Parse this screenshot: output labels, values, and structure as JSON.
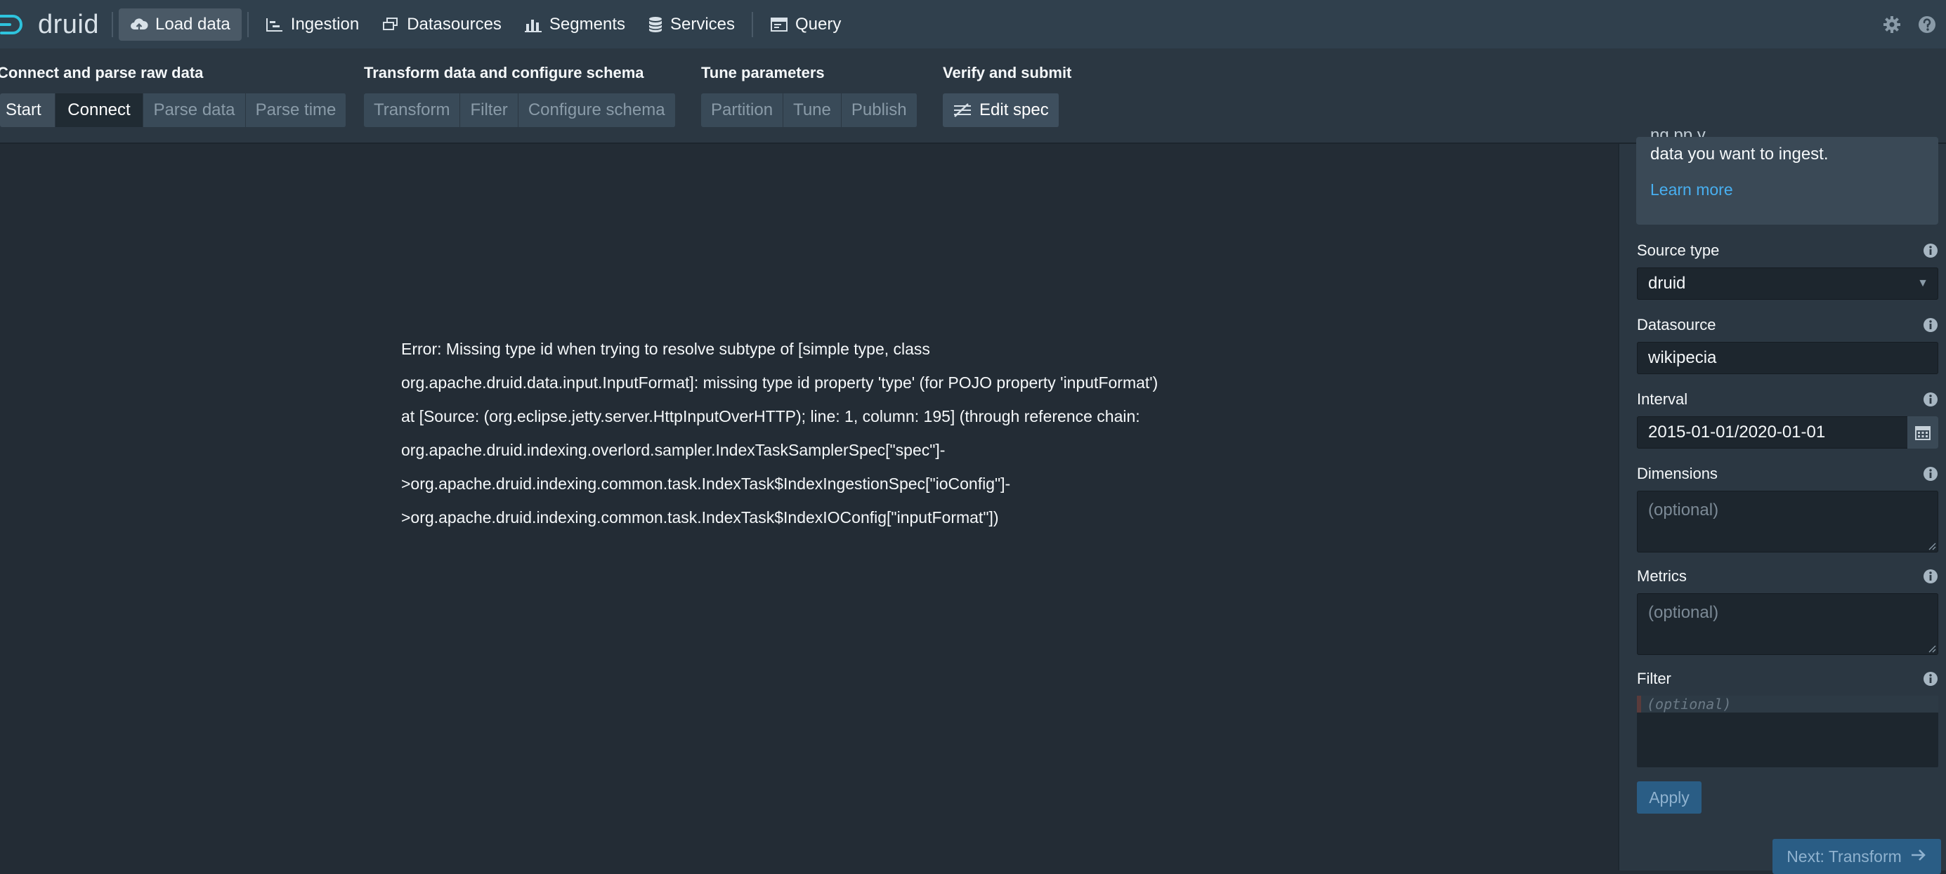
{
  "nav": {
    "logo_text": "druid",
    "items": [
      {
        "label": "Load data",
        "icon": "cloud-upload-icon"
      },
      {
        "label": "Ingestion",
        "icon": "gantt-chart-icon"
      },
      {
        "label": "Datasources",
        "icon": "multi-select-icon"
      },
      {
        "label": "Segments",
        "icon": "stacked-chart-icon"
      },
      {
        "label": "Services",
        "icon": "database-icon"
      },
      {
        "label": "Query",
        "icon": "application-icon"
      }
    ],
    "right_icons": [
      "cog-icon",
      "help-icon"
    ]
  },
  "steps": {
    "groups": [
      {
        "title": "Connect and parse raw data",
        "steps": [
          "Start",
          "Connect",
          "Parse data",
          "Parse time"
        ]
      },
      {
        "title": "Transform data and configure schema",
        "steps": [
          "Transform",
          "Filter",
          "Configure schema"
        ]
      },
      {
        "title": "Tune parameters",
        "steps": [
          "Partition",
          "Tune",
          "Publish"
        ]
      },
      {
        "title": "Verify and submit",
        "steps": [
          "Edit spec"
        ]
      }
    ]
  },
  "main": {
    "error_lines": [
      "Error: Missing type id when trying to resolve subtype of [simple type, class",
      "org.apache.druid.data.input.InputFormat]: missing type id property 'type' (for POJO property 'inputFormat')",
      "at [Source: (org.eclipse.jetty.server.HttpInputOverHTTP); line: 1, column: 195] (through reference chain:",
      "org.apache.druid.indexing.overlord.sampler.IndexTaskSamplerSpec[\"spec\"]-",
      ">org.apache.druid.indexing.common.task.IndexTask$IndexIngestionSpec[\"ioConfig\"]-",
      ">org.apache.druid.indexing.common.task.IndexTask$IndexIOConfig[\"inputFormat\"])"
    ]
  },
  "sidebar": {
    "callout": {
      "partial_text": "ng       pp       y",
      "text": "data you want to ingest.",
      "link": "Learn more"
    },
    "source_type": {
      "label": "Source type",
      "value": "druid"
    },
    "datasource": {
      "label": "Datasource",
      "value": "wikipecia"
    },
    "interval": {
      "label": "Interval",
      "value": "2015-01-01/2020-01-01"
    },
    "dimensions": {
      "label": "Dimensions",
      "placeholder": "(optional)"
    },
    "metrics": {
      "label": "Metrics",
      "placeholder": "(optional)"
    },
    "filter": {
      "label": "Filter",
      "placeholder": "(optional)"
    },
    "apply_label": "Apply",
    "next_label": "Next: Transform"
  }
}
